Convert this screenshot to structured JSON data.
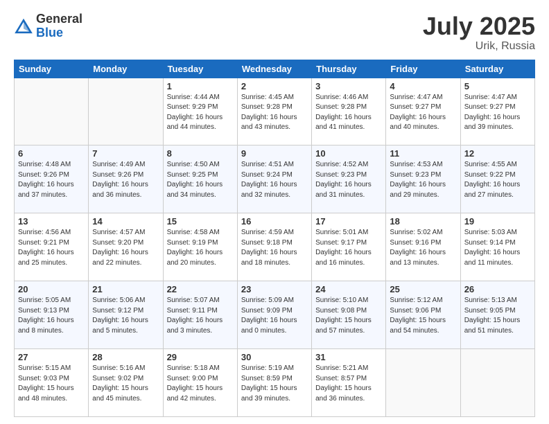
{
  "logo": {
    "general": "General",
    "blue": "Blue"
  },
  "title": {
    "month_year": "July 2025",
    "location": "Urik, Russia"
  },
  "weekdays": [
    "Sunday",
    "Monday",
    "Tuesday",
    "Wednesday",
    "Thursday",
    "Friday",
    "Saturday"
  ],
  "weeks": [
    [
      {
        "day": "",
        "sunrise": "",
        "sunset": "",
        "daylight": ""
      },
      {
        "day": "",
        "sunrise": "",
        "sunset": "",
        "daylight": ""
      },
      {
        "day": "1",
        "sunrise": "Sunrise: 4:44 AM",
        "sunset": "Sunset: 9:29 PM",
        "daylight": "Daylight: 16 hours and 44 minutes."
      },
      {
        "day": "2",
        "sunrise": "Sunrise: 4:45 AM",
        "sunset": "Sunset: 9:28 PM",
        "daylight": "Daylight: 16 hours and 43 minutes."
      },
      {
        "day": "3",
        "sunrise": "Sunrise: 4:46 AM",
        "sunset": "Sunset: 9:28 PM",
        "daylight": "Daylight: 16 hours and 41 minutes."
      },
      {
        "day": "4",
        "sunrise": "Sunrise: 4:47 AM",
        "sunset": "Sunset: 9:27 PM",
        "daylight": "Daylight: 16 hours and 40 minutes."
      },
      {
        "day": "5",
        "sunrise": "Sunrise: 4:47 AM",
        "sunset": "Sunset: 9:27 PM",
        "daylight": "Daylight: 16 hours and 39 minutes."
      }
    ],
    [
      {
        "day": "6",
        "sunrise": "Sunrise: 4:48 AM",
        "sunset": "Sunset: 9:26 PM",
        "daylight": "Daylight: 16 hours and 37 minutes."
      },
      {
        "day": "7",
        "sunrise": "Sunrise: 4:49 AM",
        "sunset": "Sunset: 9:26 PM",
        "daylight": "Daylight: 16 hours and 36 minutes."
      },
      {
        "day": "8",
        "sunrise": "Sunrise: 4:50 AM",
        "sunset": "Sunset: 9:25 PM",
        "daylight": "Daylight: 16 hours and 34 minutes."
      },
      {
        "day": "9",
        "sunrise": "Sunrise: 4:51 AM",
        "sunset": "Sunset: 9:24 PM",
        "daylight": "Daylight: 16 hours and 32 minutes."
      },
      {
        "day": "10",
        "sunrise": "Sunrise: 4:52 AM",
        "sunset": "Sunset: 9:23 PM",
        "daylight": "Daylight: 16 hours and 31 minutes."
      },
      {
        "day": "11",
        "sunrise": "Sunrise: 4:53 AM",
        "sunset": "Sunset: 9:23 PM",
        "daylight": "Daylight: 16 hours and 29 minutes."
      },
      {
        "day": "12",
        "sunrise": "Sunrise: 4:55 AM",
        "sunset": "Sunset: 9:22 PM",
        "daylight": "Daylight: 16 hours and 27 minutes."
      }
    ],
    [
      {
        "day": "13",
        "sunrise": "Sunrise: 4:56 AM",
        "sunset": "Sunset: 9:21 PM",
        "daylight": "Daylight: 16 hours and 25 minutes."
      },
      {
        "day": "14",
        "sunrise": "Sunrise: 4:57 AM",
        "sunset": "Sunset: 9:20 PM",
        "daylight": "Daylight: 16 hours and 22 minutes."
      },
      {
        "day": "15",
        "sunrise": "Sunrise: 4:58 AM",
        "sunset": "Sunset: 9:19 PM",
        "daylight": "Daylight: 16 hours and 20 minutes."
      },
      {
        "day": "16",
        "sunrise": "Sunrise: 4:59 AM",
        "sunset": "Sunset: 9:18 PM",
        "daylight": "Daylight: 16 hours and 18 minutes."
      },
      {
        "day": "17",
        "sunrise": "Sunrise: 5:01 AM",
        "sunset": "Sunset: 9:17 PM",
        "daylight": "Daylight: 16 hours and 16 minutes."
      },
      {
        "day": "18",
        "sunrise": "Sunrise: 5:02 AM",
        "sunset": "Sunset: 9:16 PM",
        "daylight": "Daylight: 16 hours and 13 minutes."
      },
      {
        "day": "19",
        "sunrise": "Sunrise: 5:03 AM",
        "sunset": "Sunset: 9:14 PM",
        "daylight": "Daylight: 16 hours and 11 minutes."
      }
    ],
    [
      {
        "day": "20",
        "sunrise": "Sunrise: 5:05 AM",
        "sunset": "Sunset: 9:13 PM",
        "daylight": "Daylight: 16 hours and 8 minutes."
      },
      {
        "day": "21",
        "sunrise": "Sunrise: 5:06 AM",
        "sunset": "Sunset: 9:12 PM",
        "daylight": "Daylight: 16 hours and 5 minutes."
      },
      {
        "day": "22",
        "sunrise": "Sunrise: 5:07 AM",
        "sunset": "Sunset: 9:11 PM",
        "daylight": "Daylight: 16 hours and 3 minutes."
      },
      {
        "day": "23",
        "sunrise": "Sunrise: 5:09 AM",
        "sunset": "Sunset: 9:09 PM",
        "daylight": "Daylight: 16 hours and 0 minutes."
      },
      {
        "day": "24",
        "sunrise": "Sunrise: 5:10 AM",
        "sunset": "Sunset: 9:08 PM",
        "daylight": "Daylight: 15 hours and 57 minutes."
      },
      {
        "day": "25",
        "sunrise": "Sunrise: 5:12 AM",
        "sunset": "Sunset: 9:06 PM",
        "daylight": "Daylight: 15 hours and 54 minutes."
      },
      {
        "day": "26",
        "sunrise": "Sunrise: 5:13 AM",
        "sunset": "Sunset: 9:05 PM",
        "daylight": "Daylight: 15 hours and 51 minutes."
      }
    ],
    [
      {
        "day": "27",
        "sunrise": "Sunrise: 5:15 AM",
        "sunset": "Sunset: 9:03 PM",
        "daylight": "Daylight: 15 hours and 48 minutes."
      },
      {
        "day": "28",
        "sunrise": "Sunrise: 5:16 AM",
        "sunset": "Sunset: 9:02 PM",
        "daylight": "Daylight: 15 hours and 45 minutes."
      },
      {
        "day": "29",
        "sunrise": "Sunrise: 5:18 AM",
        "sunset": "Sunset: 9:00 PM",
        "daylight": "Daylight: 15 hours and 42 minutes."
      },
      {
        "day": "30",
        "sunrise": "Sunrise: 5:19 AM",
        "sunset": "Sunset: 8:59 PM",
        "daylight": "Daylight: 15 hours and 39 minutes."
      },
      {
        "day": "31",
        "sunrise": "Sunrise: 5:21 AM",
        "sunset": "Sunset: 8:57 PM",
        "daylight": "Daylight: 15 hours and 36 minutes."
      },
      {
        "day": "",
        "sunrise": "",
        "sunset": "",
        "daylight": ""
      },
      {
        "day": "",
        "sunrise": "",
        "sunset": "",
        "daylight": ""
      }
    ]
  ]
}
